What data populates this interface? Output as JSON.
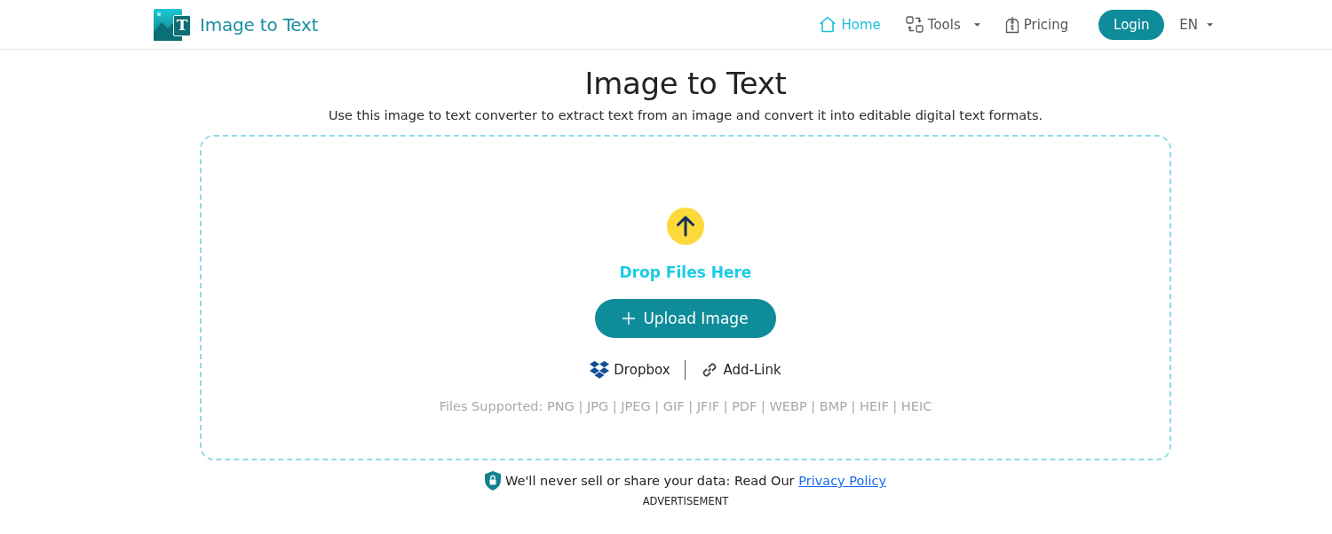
{
  "header": {
    "logo": {
      "mark": "T",
      "text": "Image to Text"
    },
    "nav": [
      {
        "label": "Home",
        "kind": "home",
        "dropdown": false,
        "selected": true
      },
      {
        "label": "Tools",
        "kind": "tools",
        "dropdown": true,
        "selected": false
      },
      {
        "label": "Pricing",
        "kind": "pricing",
        "dropdown": false,
        "selected": false
      }
    ],
    "login_button": "Login",
    "language": "EN"
  },
  "hero": {
    "title": "Image to Text",
    "subtitle": "Use this image to text converter to extract text from an image and convert it into editable digital text formats."
  },
  "dropzone": {
    "prompt": "Drop Files Here",
    "upload_button": "Upload Image",
    "sources": [
      {
        "label": "Dropbox",
        "kind": "dropbox"
      },
      {
        "label": "Add-Link",
        "kind": "link"
      }
    ],
    "supported": "Files Supported: PNG | JPG | JPEG | GIF | JFIF | PDF | WEBP | BMP | HEIF | HEIC"
  },
  "privacy": {
    "text": "We'll never sell or share your data: Read Our",
    "link": "Privacy Policy"
  },
  "advertisement": "ADVERTISEMENT"
}
